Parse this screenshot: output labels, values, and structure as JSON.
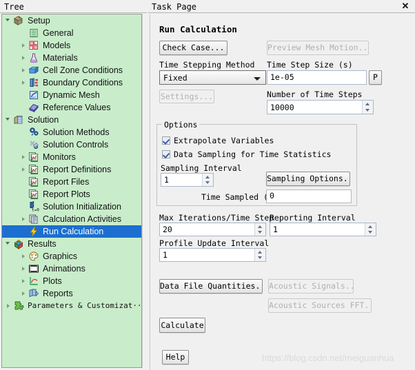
{
  "tree": {
    "header": "Tree",
    "items": [
      {
        "label": "Setup",
        "icon": "setup-icon",
        "indent": 0,
        "twist": "open",
        "selected": false
      },
      {
        "label": "General",
        "icon": "general-icon",
        "indent": 1,
        "twist": "none",
        "selected": false
      },
      {
        "label": "Models",
        "icon": "models-icon",
        "indent": 1,
        "twist": "closed",
        "selected": false
      },
      {
        "label": "Materials",
        "icon": "materials-icon",
        "indent": 1,
        "twist": "closed",
        "selected": false
      },
      {
        "label": "Cell Zone Conditions",
        "icon": "cell-zone-icon",
        "indent": 1,
        "twist": "closed",
        "selected": false
      },
      {
        "label": "Boundary Conditions",
        "icon": "boundary-conditions-icon",
        "indent": 1,
        "twist": "closed",
        "selected": false
      },
      {
        "label": "Dynamic Mesh",
        "icon": "dynamic-mesh-icon",
        "indent": 1,
        "twist": "none",
        "selected": false
      },
      {
        "label": "Reference Values",
        "icon": "reference-values-icon",
        "indent": 1,
        "twist": "none",
        "selected": false
      },
      {
        "label": "Solution",
        "icon": "solution-icon",
        "indent": 0,
        "twist": "open",
        "selected": false
      },
      {
        "label": "Solution Methods",
        "icon": "solution-methods-icon",
        "indent": 1,
        "twist": "none",
        "selected": false
      },
      {
        "label": "Solution Controls",
        "icon": "solution-controls-icon",
        "indent": 1,
        "twist": "none",
        "selected": false
      },
      {
        "label": "Monitors",
        "icon": "monitors-icon",
        "indent": 1,
        "twist": "closed",
        "selected": false
      },
      {
        "label": "Report Definitions",
        "icon": "report-definitions-icon",
        "indent": 1,
        "twist": "closed",
        "selected": false
      },
      {
        "label": "Report Files",
        "icon": "report-files-icon",
        "indent": 1,
        "twist": "none",
        "selected": false
      },
      {
        "label": "Report Plots",
        "icon": "report-plots-icon",
        "indent": 1,
        "twist": "none",
        "selected": false
      },
      {
        "label": "Solution Initialization",
        "icon": "solution-initialization-icon",
        "indent": 1,
        "twist": "none",
        "selected": false
      },
      {
        "label": "Calculation Activities",
        "icon": "calculation-activities-icon",
        "indent": 1,
        "twist": "closed",
        "selected": false
      },
      {
        "label": "Run Calculation",
        "icon": "run-calculation-icon",
        "indent": 1,
        "twist": "none",
        "selected": true
      },
      {
        "label": "Results",
        "icon": "results-icon",
        "indent": 0,
        "twist": "open",
        "selected": false
      },
      {
        "label": "Graphics",
        "icon": "graphics-icon",
        "indent": 1,
        "twist": "closed",
        "selected": false
      },
      {
        "label": "Animations",
        "icon": "animations-icon",
        "indent": 1,
        "twist": "closed",
        "selected": false
      },
      {
        "label": "Plots",
        "icon": "plots-icon",
        "indent": 1,
        "twist": "closed",
        "selected": false
      },
      {
        "label": "Reports",
        "icon": "reports-icon",
        "indent": 1,
        "twist": "closed",
        "selected": false
      },
      {
        "label": "Parameters & Customizat···",
        "icon": "parameters-icon",
        "indent": 0,
        "twist": "closed",
        "selected": false,
        "mono": true
      }
    ]
  },
  "task": {
    "header": "Task Page",
    "close": "✕",
    "section_title": "Run Calculation",
    "check_case_button": "Check Case...",
    "preview_mesh_motion_button": "Preview Mesh Motion...",
    "time_stepping_method_label": "Time Stepping Method",
    "time_stepping_method_value": "Fixed",
    "settings_button": "Settings...",
    "time_step_size_label": "Time Step Size (s)",
    "time_step_size_value": "1e-05",
    "time_step_size_param_button": "P",
    "number_of_time_steps_label": "Number of Time Steps",
    "number_of_time_steps_value": "10000",
    "options_group_title": "Options",
    "extrapolate_variables_label": "Extrapolate Variables",
    "extrapolate_variables_checked": true,
    "data_sampling_label": "Data Sampling for Time Statistics",
    "data_sampling_checked": true,
    "sampling_interval_label": "Sampling Interval",
    "sampling_interval_value": "1",
    "sampling_options_button": "Sampling Options...",
    "time_sampled_label": "Time Sampled (s)",
    "time_sampled_value": "0",
    "max_iterations_label": "Max Iterations/Time Step",
    "max_iterations_value": "20",
    "reporting_interval_label": "Reporting Interval",
    "reporting_interval_value": "1",
    "profile_update_interval_label": "Profile Update Interval",
    "profile_update_interval_value": "1",
    "data_file_quantities_button": "Data File Quantities...",
    "acoustic_signals_button": "Acoustic Signals...",
    "acoustic_sources_fft_button": "Acoustic Sources FFT...",
    "calculate_button": "Calculate",
    "help_button": "Help"
  },
  "watermark": "https://blog.csdn.net/meiguanhua",
  "colors": {
    "tree_background": "#c9edcb",
    "selection": "#1c6fd0",
    "panel_background": "#f0f0f0"
  }
}
